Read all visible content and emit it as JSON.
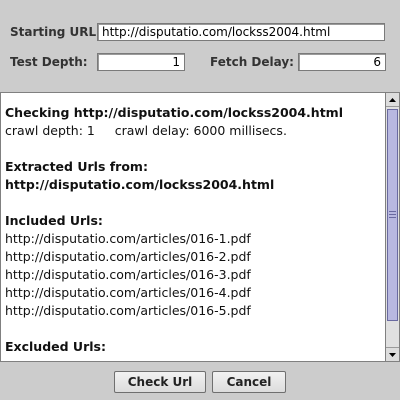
{
  "form": {
    "starting_url_label": "Starting URL:",
    "starting_url_value": "http://disputatio.com/lockss2004.html",
    "test_depth_label": "Test Depth:",
    "test_depth_value": "1",
    "fetch_delay_label": "Fetch Delay:",
    "fetch_delay_value": "6"
  },
  "output": {
    "checking_line": "Checking http://disputatio.com/lockss2004.html",
    "crawl_info": "crawl depth: 1     crawl delay: 6000 millisecs.",
    "extracted_heading": "Extracted Urls from:",
    "extracted_url": "http://disputatio.com/lockss2004.html",
    "included_heading": "Included Urls:",
    "included_urls": [
      "http://disputatio.com/articles/016-1.pdf",
      "http://disputatio.com/articles/016-2.pdf",
      "http://disputatio.com/articles/016-3.pdf",
      "http://disputatio.com/articles/016-4.pdf",
      "http://disputatio.com/articles/016-5.pdf"
    ],
    "excluded_heading": "Excluded Urls:"
  },
  "buttons": {
    "check_url": "Check Url",
    "cancel": "Cancel"
  },
  "scrollbar": {
    "thumb_color": "#b8b8e0"
  }
}
